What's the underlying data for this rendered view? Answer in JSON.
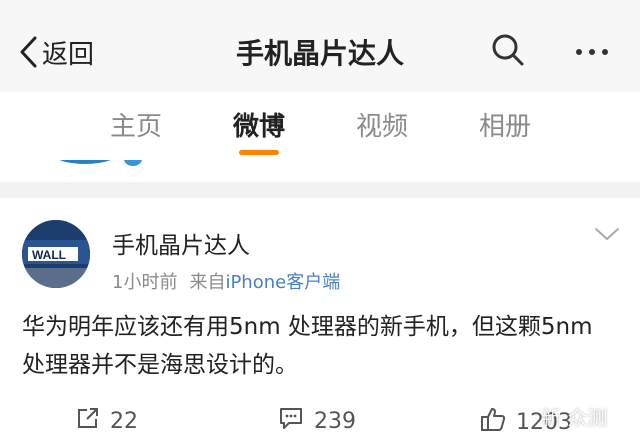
{
  "header": {
    "back_label": "返回",
    "title": "手机晶片达人"
  },
  "tabs": [
    {
      "label": "主页",
      "active": false
    },
    {
      "label": "微博",
      "active": true
    },
    {
      "label": "视频",
      "active": false
    },
    {
      "label": "相册",
      "active": false
    }
  ],
  "post": {
    "author": "手机晶片达人",
    "time": "1小时前",
    "source_prefix": "来自",
    "source": "iPhone客户端",
    "text": "华为明年应该还有用5nm 处理器的新手机，但这颗5nm 处理器并不是海思设计的。",
    "reposts": "22",
    "comments": "239",
    "likes": "1203"
  },
  "avatar_text": "WALL",
  "watermark": "新 众测",
  "colors": {
    "accent": "#ff8200",
    "link": "#4a80c5",
    "navbar_bg": "#f7f7f7"
  },
  "icons": [
    "back-arrow-icon",
    "search-icon",
    "more-icon",
    "chevron-down-icon",
    "repost-icon",
    "comment-icon",
    "like-icon"
  ]
}
